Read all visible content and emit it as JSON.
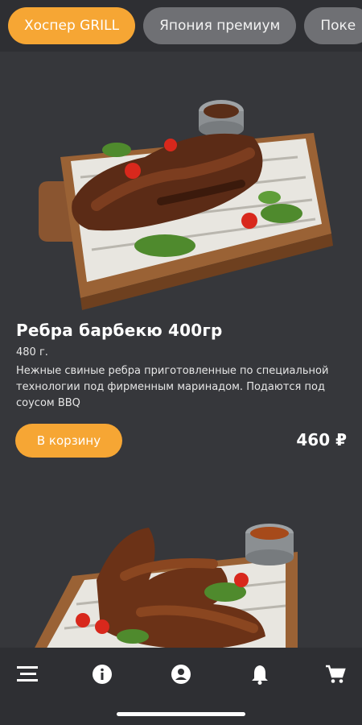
{
  "categories": [
    {
      "label": "Хоспер GRILL",
      "active": true
    },
    {
      "label": "Япония премиум",
      "active": false
    },
    {
      "label": "Поке",
      "active": false
    }
  ],
  "product": {
    "title": "Ребра барбекю 400гр",
    "weight": "480 г.",
    "description": "Нежные свиные ребра приготовленные по специальной технологии под фирменным маринадом. Подаются под соусом BBQ",
    "add_to_cart_label": "В корзину",
    "price": "460 ₽"
  },
  "colors": {
    "accent": "#f6a634",
    "background": "#36373b",
    "bars": "#2e2f33"
  },
  "bottom_nav": [
    {
      "icon": "menu-icon"
    },
    {
      "icon": "info-icon"
    },
    {
      "icon": "account-icon"
    },
    {
      "icon": "bell-icon"
    },
    {
      "icon": "cart-icon"
    }
  ]
}
